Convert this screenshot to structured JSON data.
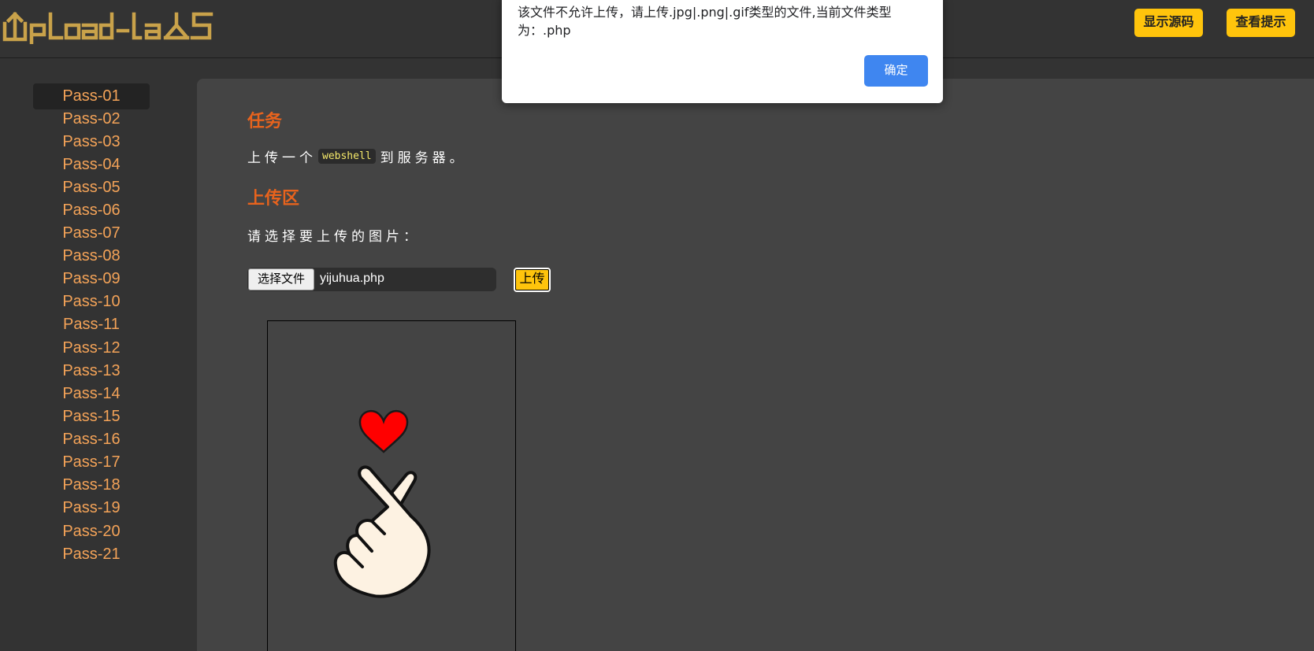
{
  "header": {
    "logo_text": "UpLoad-labS",
    "show_source_label": "显示源码",
    "view_hint_label": "查看提示"
  },
  "sidebar": {
    "items": [
      {
        "label": "Pass-01",
        "active": true
      },
      {
        "label": "Pass-02"
      },
      {
        "label": "Pass-03"
      },
      {
        "label": "Pass-04"
      },
      {
        "label": "Pass-05"
      },
      {
        "label": "Pass-06"
      },
      {
        "label": "Pass-07"
      },
      {
        "label": "Pass-08"
      },
      {
        "label": "Pass-09"
      },
      {
        "label": "Pass-10"
      },
      {
        "label": "Pass-11"
      },
      {
        "label": "Pass-12"
      },
      {
        "label": "Pass-13"
      },
      {
        "label": "Pass-14"
      },
      {
        "label": "Pass-15"
      },
      {
        "label": "Pass-16"
      },
      {
        "label": "Pass-17"
      },
      {
        "label": "Pass-18"
      },
      {
        "label": "Pass-19"
      },
      {
        "label": "Pass-20"
      },
      {
        "label": "Pass-21"
      }
    ]
  },
  "main": {
    "task_heading": "任务",
    "task_prefix": "上传一个",
    "task_code": "webshell",
    "task_suffix": "到服务器。",
    "upload_heading": "上传区",
    "choose_prompt": "请选择要上传的图片：",
    "choose_file_label": "选择文件",
    "file_name": "yijuhua.php",
    "upload_button_label": "上传"
  },
  "dialog": {
    "message": "该文件不允许上传，请上传.jpg|.png|.gif类型的文件,当前文件类型为：.php",
    "ok_label": "确定"
  },
  "colors": {
    "accent_yellow": "#ffc40c",
    "heading_orange": "#e8631d",
    "nav_orange": "#f4a358",
    "dialog_button_blue": "#3f86f0"
  },
  "icons": {
    "preview_image": "finger-heart-icon",
    "logo": "upload-labs-logo"
  }
}
